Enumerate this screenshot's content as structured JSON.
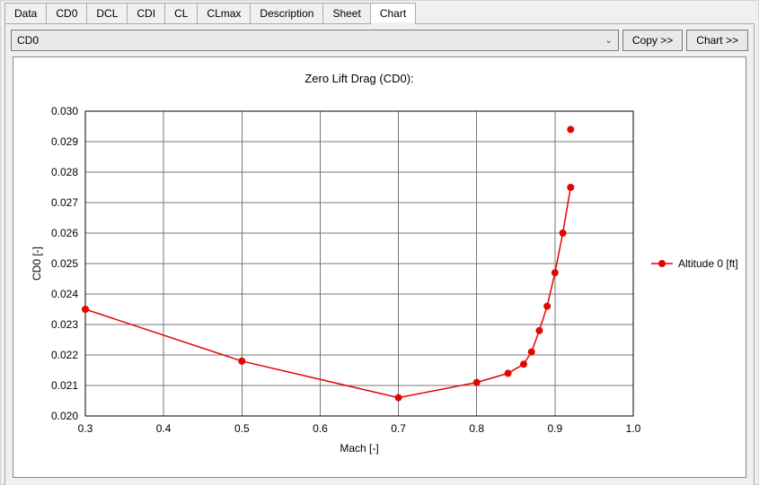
{
  "tabs": [
    "Data",
    "CD0",
    "DCL",
    "CDI",
    "CL",
    "CLmax",
    "Description",
    "Sheet",
    "Chart"
  ],
  "toolbar": {
    "select_value": "CD0",
    "copy_label": "Copy >>",
    "chart_label": "Chart >>"
  },
  "chart_data": {
    "type": "line",
    "title": "Zero Lift Drag (CD0):",
    "xlabel": "Mach [-]",
    "ylabel": "CD0 [-]",
    "xlim": [
      0.3,
      1.0
    ],
    "ylim": [
      0.02,
      0.03
    ],
    "xticks": [
      0.3,
      0.4,
      0.5,
      0.6,
      0.7,
      0.8,
      0.9,
      1.0
    ],
    "yticks": [
      0.02,
      0.021,
      0.022,
      0.023,
      0.024,
      0.025,
      0.026,
      0.027,
      0.028,
      0.029,
      0.03
    ],
    "series": [
      {
        "name": "Altitude 0 [ft]",
        "color": "#e10600",
        "x": [
          0.3,
          0.5,
          0.7,
          0.8,
          0.84,
          0.86,
          0.87,
          0.88,
          0.89,
          0.9,
          0.91,
          0.92
        ],
        "y": [
          0.0235,
          0.0218,
          0.0206,
          0.0211,
          0.0214,
          0.0217,
          0.0221,
          0.0228,
          0.0236,
          0.0247,
          0.026,
          0.0275
        ]
      }
    ],
    "extra_point": {
      "x": 0.92,
      "y": 0.0294
    },
    "legend_position": "right"
  }
}
